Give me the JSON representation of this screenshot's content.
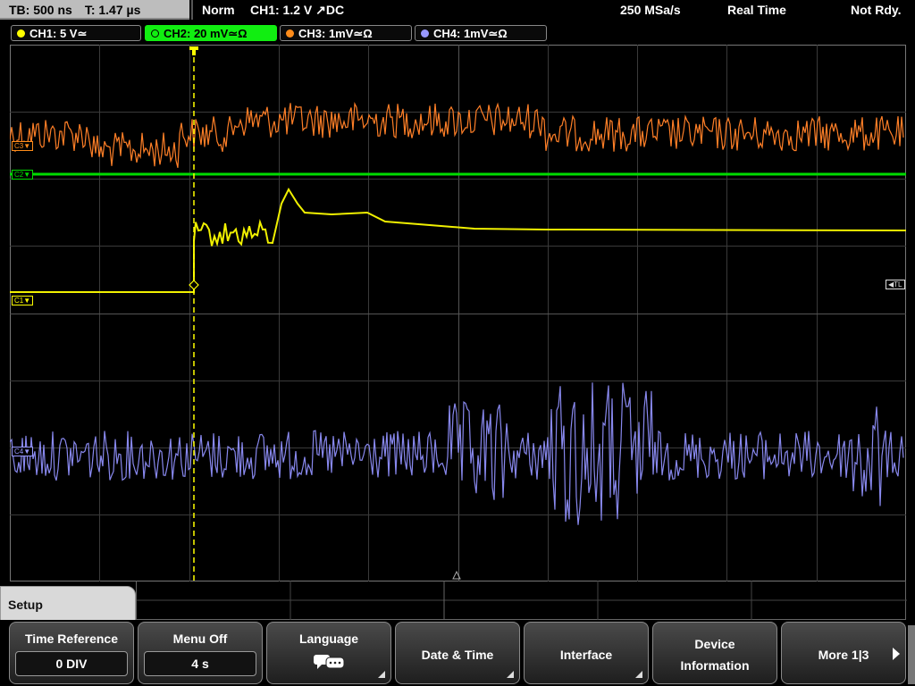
{
  "status": {
    "timebase": "TB: 500 ns",
    "trigger_time": "T: 1.47 µs",
    "mode": "Norm",
    "trigger": "CH1: 1.2 V ↗DC",
    "sample_rate": "250 MSa/s",
    "acq_mode": "Real Time",
    "state": "Not Rdy."
  },
  "channels": [
    {
      "label": "CH1: 5 V≃",
      "color": "#ffff00",
      "active": false
    },
    {
      "label": "CH2: 20 mV≃Ω",
      "color": "#00dd00",
      "active": true
    },
    {
      "label": "CH3: 1mV≃Ω",
      "color": "#ff8c1a",
      "active": false
    },
    {
      "label": "CH4: 1mV≃Ω",
      "color": "#9999ff",
      "active": false
    }
  ],
  "markers": {
    "c1": "C1",
    "c2": "C2",
    "c3": "C3",
    "c4": "C4",
    "trigger_level": "TL",
    "trigger_pos": "T"
  },
  "menu": {
    "title": "Setup",
    "buttons": [
      {
        "label": "Time Reference",
        "value": "0 DIV"
      },
      {
        "label": "Menu Off",
        "value": "4 s"
      },
      {
        "label": "Language",
        "icon": "speech-bubbles-icon"
      },
      {
        "label": "Date & Time"
      },
      {
        "label": "Interface"
      },
      {
        "label": "Device",
        "label2": "Information"
      },
      {
        "label": "More 1|3",
        "icon": "right-arrow-icon"
      }
    ]
  }
}
